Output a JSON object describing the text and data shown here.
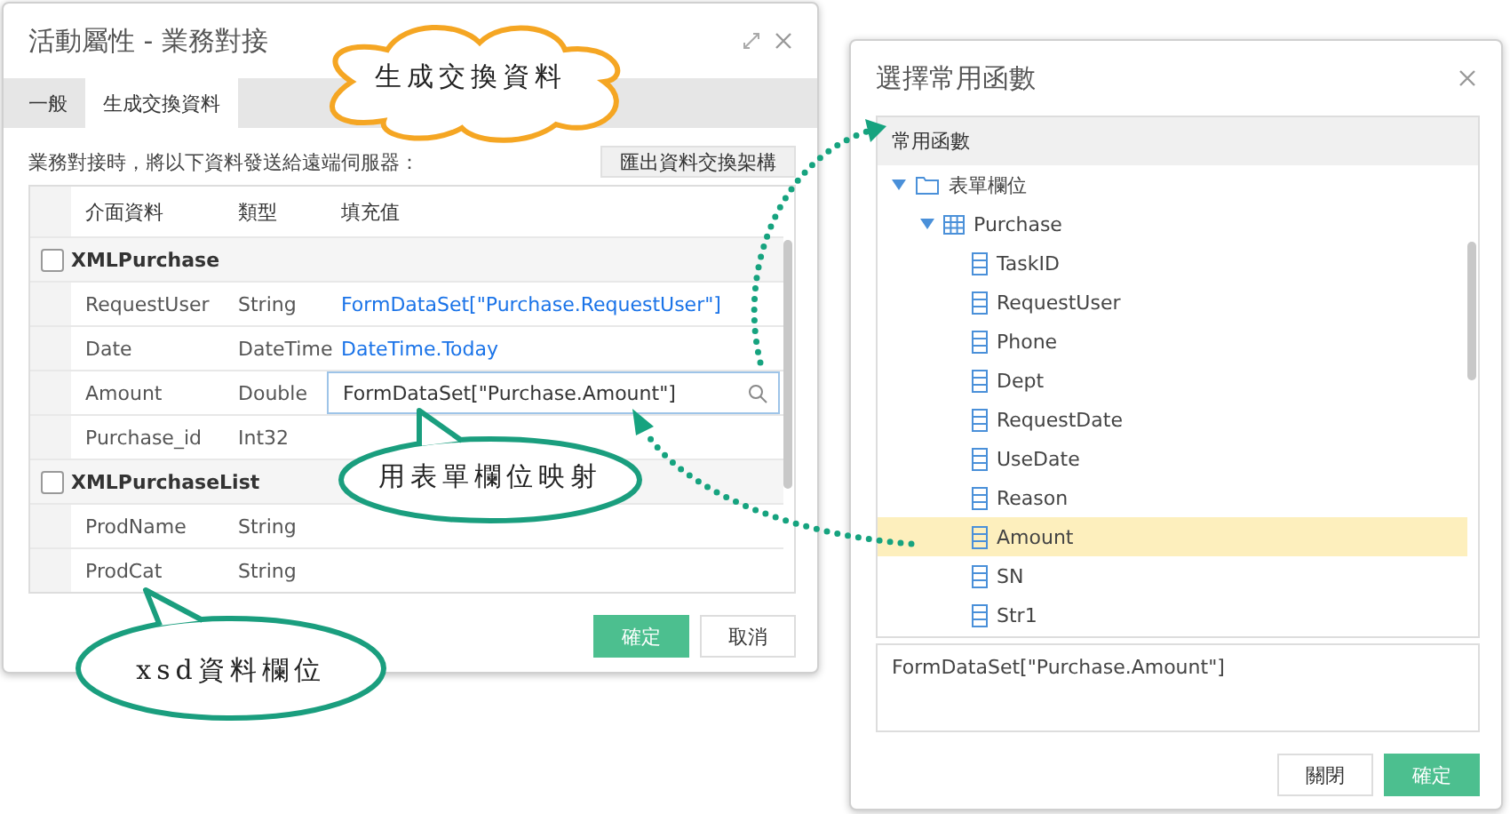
{
  "main_dialog": {
    "title": "活動屬性 - 業務對接",
    "tabs": [
      {
        "label": "一般",
        "selected": false
      },
      {
        "label": "生成交換資料",
        "selected": true
      }
    ],
    "description": "業務對接時，將以下資料發送給遠端伺服器：",
    "export_button": "匯出資料交換架構",
    "table": {
      "columns": [
        "介面資料",
        "類型",
        "填充值"
      ],
      "groups": [
        {
          "name": "XMLPurchase",
          "checked": false,
          "rows": [
            {
              "name": "RequestUser",
              "type": "String",
              "kind": "link",
              "value": "FormDataSet[\"Purchase.RequestUser\"]"
            },
            {
              "name": "Date",
              "type": "DateTime",
              "kind": "link",
              "value": "DateTime.Today"
            },
            {
              "name": "Amount",
              "type": "Double",
              "kind": "input",
              "value": "FormDataSet[\"Purchase.Amount\"]"
            },
            {
              "name": "Purchase_id",
              "type": "Int32",
              "kind": "empty"
            }
          ]
        },
        {
          "name": "XMLPurchaseList",
          "checked": false,
          "rows": [
            {
              "name": "ProdName",
              "type": "String",
              "kind": "empty"
            },
            {
              "name": "ProdCat",
              "type": "String",
              "kind": "empty"
            }
          ]
        }
      ]
    },
    "buttons": [
      {
        "label": "確定",
        "kind": "primary"
      },
      {
        "label": "取消",
        "kind": "default"
      }
    ]
  },
  "function_dialog": {
    "title": "選擇常用函數",
    "tree": {
      "header": "常用函數",
      "items": [
        {
          "label": "表單欄位",
          "kind": "folder",
          "expanded": true,
          "children": [
            {
              "label": "Purchase",
              "kind": "table",
              "expanded": true,
              "children": [
                {
                  "label": "TaskID",
                  "kind": "field",
                  "selected": false
                },
                {
                  "label": "RequestUser",
                  "kind": "field",
                  "selected": false
                },
                {
                  "label": "Phone",
                  "kind": "field",
                  "selected": false
                },
                {
                  "label": "Dept",
                  "kind": "field",
                  "selected": false
                },
                {
                  "label": "RequestDate",
                  "kind": "field",
                  "selected": false
                },
                {
                  "label": "UseDate",
                  "kind": "field",
                  "selected": false
                },
                {
                  "label": "Reason",
                  "kind": "field",
                  "selected": false
                },
                {
                  "label": "Amount",
                  "kind": "field",
                  "selected": true
                },
                {
                  "label": "SN",
                  "kind": "field",
                  "selected": false
                },
                {
                  "label": "Str1",
                  "kind": "field",
                  "selected": false
                }
              ]
            }
          ]
        }
      ]
    },
    "expression": "FormDataSet[\"Purchase.Amount\"]",
    "buttons": [
      {
        "label": "關閉",
        "kind": "default"
      },
      {
        "label": "確定",
        "kind": "primary"
      }
    ]
  },
  "annotations": [
    {
      "kind": "cloud",
      "text": "生成交換資料"
    },
    {
      "kind": "bubble",
      "text": "用表單欄位映射"
    },
    {
      "kind": "bubble",
      "text": "xsd資料欄位"
    }
  ]
}
